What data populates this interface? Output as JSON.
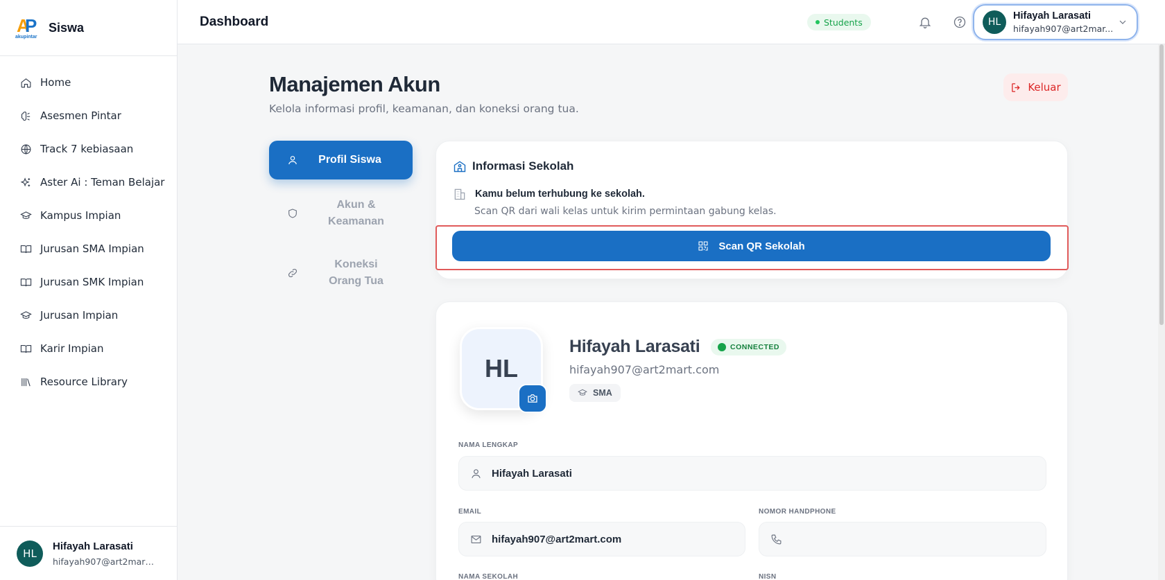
{
  "app": {
    "brand_name": "Siswa",
    "logo_text": "AP",
    "logo_sub": "akupintar"
  },
  "sidebar": {
    "items": [
      {
        "label": "Home",
        "icon": "home-icon"
      },
      {
        "label": "Asesmen Pintar",
        "icon": "brain-icon"
      },
      {
        "label": "Track 7 kebiasaan",
        "icon": "globe-icon"
      },
      {
        "label": "Aster Ai : Teman Belajar",
        "icon": "sparkle-icon"
      },
      {
        "label": "Kampus Impian",
        "icon": "graduation-cap-icon"
      },
      {
        "label": "Jurusan SMA Impian",
        "icon": "book-icon"
      },
      {
        "label": "Jurusan SMK Impian",
        "icon": "book-icon"
      },
      {
        "label": "Jurusan Impian",
        "icon": "graduation-cap-icon"
      },
      {
        "label": "Karir Impian",
        "icon": "book-icon"
      },
      {
        "label": "Resource Library",
        "icon": "library-icon"
      }
    ],
    "user": {
      "initials": "HL",
      "name": "Hifayah Larasati",
      "email": "hifayah907@art2mart.c..."
    }
  },
  "header": {
    "title": "Dashboard",
    "role_badge": "Students",
    "user": {
      "initials": "HL",
      "name": "Hifayah Larasati",
      "email": "hifayah907@art2mar..."
    }
  },
  "page": {
    "title": "Manajemen Akun",
    "subtitle": "Kelola informasi profil, keamanan, dan koneksi orang tua.",
    "logout_label": "Keluar"
  },
  "tabs": [
    {
      "label": "Profil Siswa",
      "active": true
    },
    {
      "label": "Akun & Keamanan",
      "active": false
    },
    {
      "label": "Koneksi Orang Tua",
      "active": false
    }
  ],
  "school_card": {
    "heading": "Informasi Sekolah",
    "message": "Kamu belum terhubung ke sekolah.",
    "hint": "Scan QR dari wali kelas untuk kirim permintaan gabung kelas.",
    "button_label": "Scan QR Sekolah"
  },
  "profile": {
    "initials": "HL",
    "name": "Hifayah Larasati",
    "status": "CONNECTED",
    "email": "hifayah907@art2mart.com",
    "level": "SMA",
    "fields": {
      "full_name_label": "NAMA LENGKAP",
      "full_name_value": "Hifayah Larasati",
      "email_label": "EMAIL",
      "email_value": "hifayah907@art2mart.com",
      "phone_label": "NOMOR HANDPHONE",
      "phone_value": "",
      "school_label": "NAMA SEKOLAH",
      "nisn_label": "NISN"
    }
  },
  "colors": {
    "primary": "#1a6fc4",
    "danger": "#dc2626",
    "success": "#16a34a",
    "avatar_bg": "#0f5c5a",
    "highlight": "#e05a5a"
  }
}
